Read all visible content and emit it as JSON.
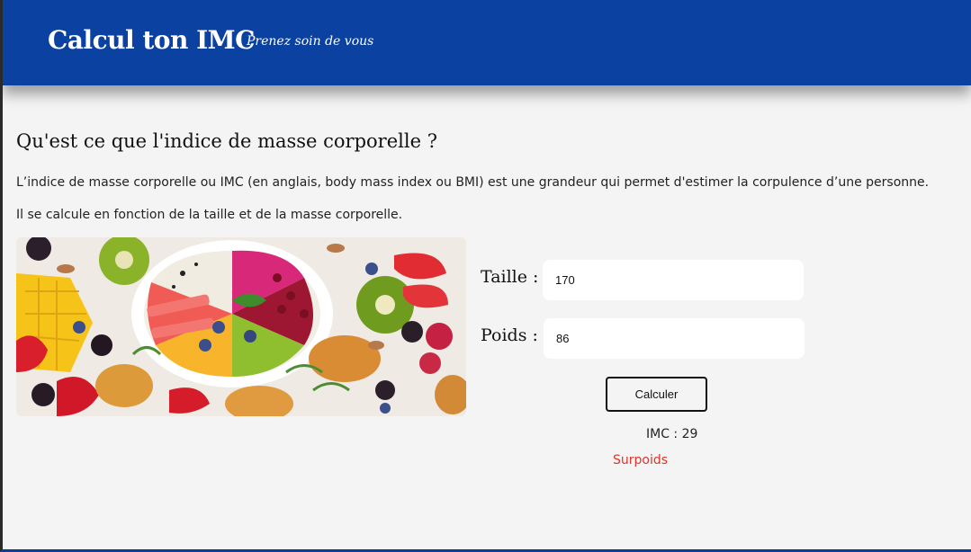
{
  "header": {
    "brand": "Calcul ton IMC",
    "tagline": "Prenez soin de vous"
  },
  "main": {
    "title": "Qu'est ce que l'indice de masse corporelle ?",
    "paragraph1": "L’indice de masse corporelle ou IMC (en anglais, body mass index ou BMI) est une grandeur qui permet d'estimer la corpulence d’une personne.",
    "paragraph2": "Il se calcule en fonction de la taille et de la masse corporelle."
  },
  "form": {
    "taille_label": "Taille :",
    "taille_value": "170",
    "poids_label": "Poids :",
    "poids_value": "86",
    "button_label": "Calculer"
  },
  "result": {
    "imc_text": "IMC : 29",
    "status_text": "Surpoids",
    "status_color": "#d9362b"
  },
  "colors": {
    "header_bg": "#0b41a0",
    "page_bg": "#f4f4f4"
  }
}
